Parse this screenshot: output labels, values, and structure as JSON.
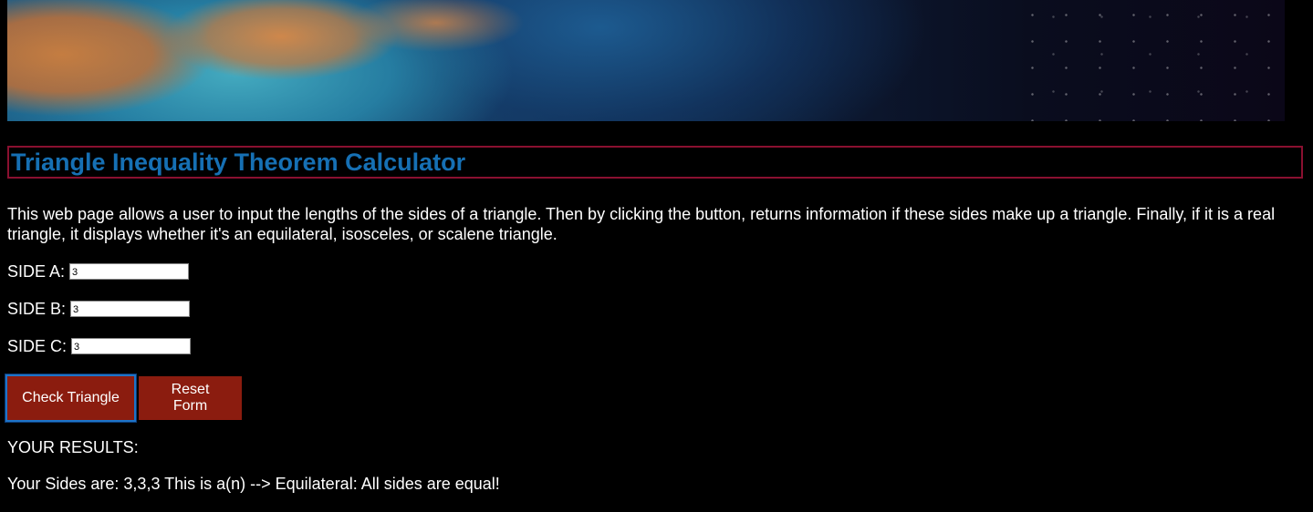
{
  "banner": {
    "description": ""
  },
  "header": {
    "title": "Triangle Inequality Theorem Calculator"
  },
  "intro": {
    "text": "This web page allows a user to input the lengths of the sides of a triangle. Then by clicking the button, returns information if these sides make up a triangle. Finally, if it is a real triangle, it displays whether it's an equilateral, isosceles, or scalene triangle."
  },
  "form": {
    "side_a": {
      "label": "SIDE A:",
      "value": "3"
    },
    "side_b": {
      "label": "SIDE B:",
      "value": "3"
    },
    "side_c": {
      "label": "SIDE C:",
      "value": "3"
    },
    "check_label": "Check Triangle",
    "reset_label": "Reset Form"
  },
  "results": {
    "heading": "YOUR RESULTS:",
    "text": "Your Sides are: 3,3,3 This is a(n) --> Equilateral: All sides are equal!"
  },
  "colors": {
    "title": "#1670b4",
    "title_border": "#8a1030",
    "button_bg": "#8b1c0f",
    "focus_ring": "#1e74c8",
    "page_bg": "#000000"
  }
}
